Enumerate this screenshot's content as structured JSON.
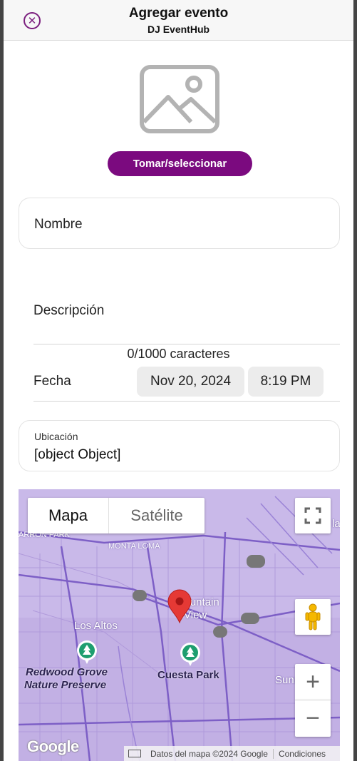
{
  "header": {
    "close_icon": "close-circle-icon",
    "title": "Agregar evento",
    "subtitle": "DJ EventHub"
  },
  "photo": {
    "icon": "image-placeholder-icon",
    "button_label": "Tomar/seleccionar"
  },
  "form": {
    "name_label": "Nombre",
    "description_label": "Descripción",
    "char_count": "0/1000 caracteres",
    "date_label": "Fecha",
    "date_value": "Nov 20, 2024",
    "time_value": "8:19 PM",
    "location_label": "Ubicación",
    "location_value": "[object Object]"
  },
  "map": {
    "type_map": "Mapa",
    "type_satellite": "Satélite",
    "labels": {
      "arroyo_park": "ARRON PARK",
      "monta_loma": "MONTA LOMA",
      "mountain_view_1": "Mountain",
      "mountain_view_2": "View",
      "los_altos": "Los Altos",
      "redwood_1": "Redwood Grove",
      "redwood_2": "Nature Preserve",
      "cuesta": "Cuesta Park",
      "sunnyvale": "Sunny",
      "la": "la"
    },
    "logo": "Google",
    "attribution": "Datos del mapa ©2024 Google",
    "terms": "Condiciones",
    "zoom_in": "+",
    "zoom_out": "−",
    "colors": {
      "land": "#c8b8e8",
      "road": "#8a6fcf",
      "pin": "#e53935",
      "park_marker": "#1e9e6f"
    }
  },
  "colors": {
    "accent": "#7b0a7f"
  }
}
